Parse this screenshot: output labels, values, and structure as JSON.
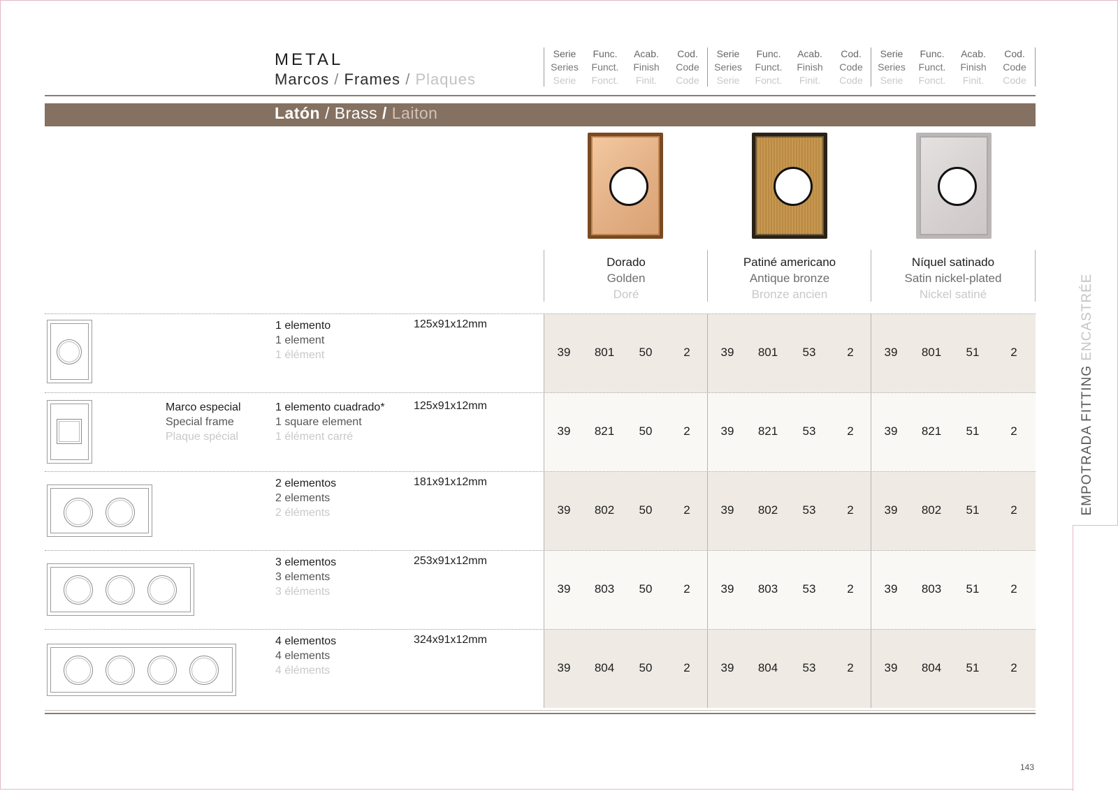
{
  "header": {
    "title": "METAL",
    "subtitle": {
      "es": "Marcos",
      "en": "Frames",
      "fr": "Plaques",
      "sep": "/"
    }
  },
  "column_headers": [
    {
      "l1": "Serie",
      "l2": "Series",
      "l3": "Serie"
    },
    {
      "l1": "Func.",
      "l2": "Funct.",
      "l3": "Fonct."
    },
    {
      "l1": "Acab.",
      "l2": "Finish",
      "l3": "Finit."
    },
    {
      "l1": "Cod.",
      "l2": "Code",
      "l3": "Code"
    }
  ],
  "section": {
    "es": "Latón",
    "en": "Brass",
    "fr": "Laiton",
    "sep": "/"
  },
  "finishes": [
    {
      "es": "Dorado",
      "en": "Golden",
      "fr": "Doré",
      "swatch": "#e6b487"
    },
    {
      "es": "Patiné americano",
      "en": "Antique bronze",
      "fr": "Bronze ancien",
      "swatch": "#c4924b"
    },
    {
      "es": "Níquel satinado",
      "en": "Satin nickel-plated",
      "fr": "Nickel satiné",
      "swatch": "#dcd7d7"
    }
  ],
  "rows": [
    {
      "group": {
        "l1": "",
        "l2": "",
        "l3": ""
      },
      "item": {
        "l1": "1 elemento",
        "l2": "1 element",
        "l3": "1 élément"
      },
      "dims": "125x91x12mm",
      "codes": [
        [
          "39",
          "801",
          "50",
          "2"
        ],
        [
          "39",
          "801",
          "53",
          "2"
        ],
        [
          "39",
          "801",
          "51",
          "2"
        ]
      ]
    },
    {
      "group": {
        "l1": "Marco especial",
        "l2": "Special frame",
        "l3": "Plaque spécial"
      },
      "item": {
        "l1": "1 elemento cuadrado*",
        "l2": "1 square element",
        "l3": "1 élément carré"
      },
      "dims": "125x91x12mm",
      "codes": [
        [
          "39",
          "821",
          "50",
          "2"
        ],
        [
          "39",
          "821",
          "53",
          "2"
        ],
        [
          "39",
          "821",
          "51",
          "2"
        ]
      ]
    },
    {
      "group": {
        "l1": "",
        "l2": "",
        "l3": ""
      },
      "item": {
        "l1": "2 elementos",
        "l2": "2 elements",
        "l3": "2 éléments"
      },
      "dims": "181x91x12mm",
      "codes": [
        [
          "39",
          "802",
          "50",
          "2"
        ],
        [
          "39",
          "802",
          "53",
          "2"
        ],
        [
          "39",
          "802",
          "51",
          "2"
        ]
      ]
    },
    {
      "group": {
        "l1": "",
        "l2": "",
        "l3": ""
      },
      "item": {
        "l1": "3 elementos",
        "l2": "3 elements",
        "l3": "3 éléments"
      },
      "dims": "253x91x12mm",
      "codes": [
        [
          "39",
          "803",
          "50",
          "2"
        ],
        [
          "39",
          "803",
          "53",
          "2"
        ],
        [
          "39",
          "803",
          "51",
          "2"
        ]
      ]
    },
    {
      "group": {
        "l1": "",
        "l2": "",
        "l3": ""
      },
      "item": {
        "l1": "4 elementos",
        "l2": "4 elements",
        "l3": "4 éléments"
      },
      "dims": "324x91x12mm",
      "codes": [
        [
          "39",
          "804",
          "50",
          "2"
        ],
        [
          "39",
          "804",
          "53",
          "2"
        ],
        [
          "39",
          "804",
          "51",
          "2"
        ]
      ]
    }
  ],
  "side_tab": {
    "dark": "EMPOTRADA FITTING",
    "light": "ENCASTRÉE"
  },
  "page_number": "143"
}
